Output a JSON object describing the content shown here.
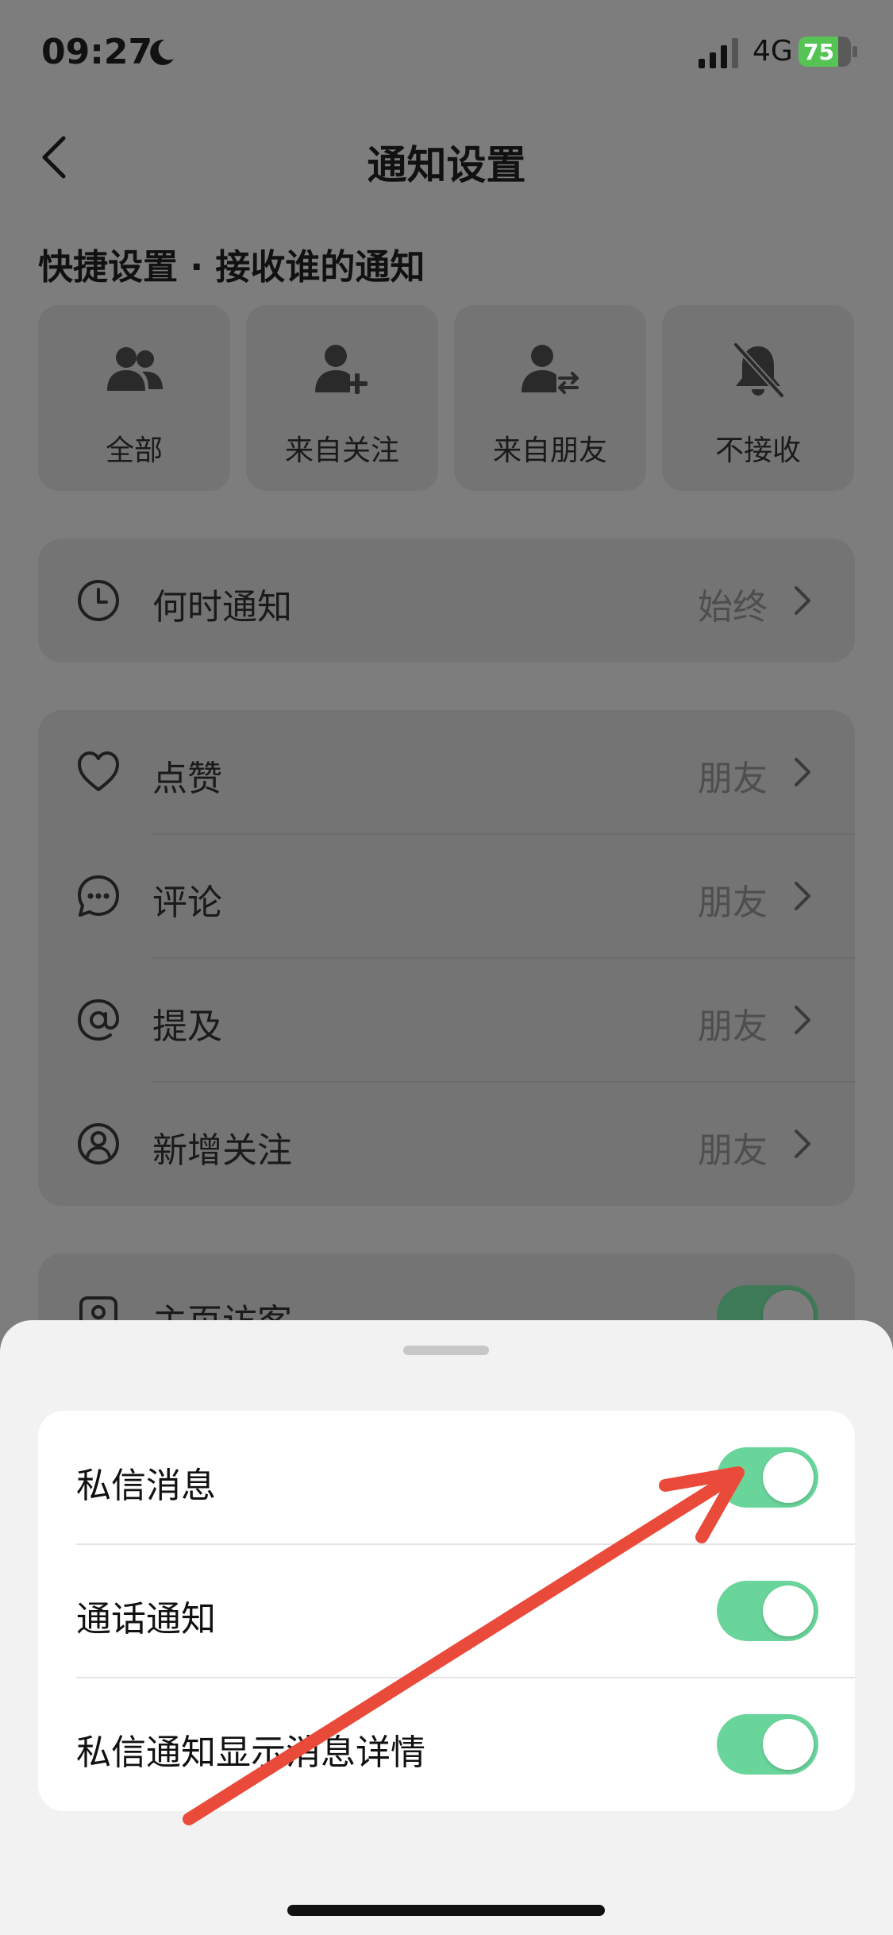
{
  "status_bar": {
    "time": "09:27",
    "network": "4G",
    "battery": "75",
    "battery_level": 0.75
  },
  "nav": {
    "title": "通知设置"
  },
  "quick": {
    "section_label": "快捷设置 · 接收谁的通知",
    "options": [
      {
        "label": "全部",
        "icon": "users-icon"
      },
      {
        "label": "来自关注",
        "icon": "user-plus-icon"
      },
      {
        "label": "来自朋友",
        "icon": "user-swap-icon"
      },
      {
        "label": "不接收",
        "icon": "bell-off-icon"
      }
    ]
  },
  "when": {
    "label": "何时通知",
    "value": "始终",
    "icon": "clock-icon"
  },
  "interactions": [
    {
      "label": "点赞",
      "value": "朋友",
      "icon": "heart-icon"
    },
    {
      "label": "评论",
      "value": "朋友",
      "icon": "comment-icon"
    },
    {
      "label": "提及",
      "value": "朋友",
      "icon": "at-icon"
    },
    {
      "label": "新增关注",
      "value": "朋友",
      "icon": "user-circle-icon"
    }
  ],
  "visitors": {
    "label": "主页访客",
    "enabled": true,
    "icon": "profile-card-icon"
  },
  "sheet": {
    "items": [
      {
        "label": "私信消息",
        "enabled": true
      },
      {
        "label": "通话通知",
        "enabled": true
      },
      {
        "label": "私信通知显示消息详情",
        "enabled": true
      }
    ]
  },
  "colors": {
    "toggle_on": "#6ad59b",
    "dim_overlay": "#7d7d7d",
    "annotation_arrow": "#e94a3a"
  }
}
